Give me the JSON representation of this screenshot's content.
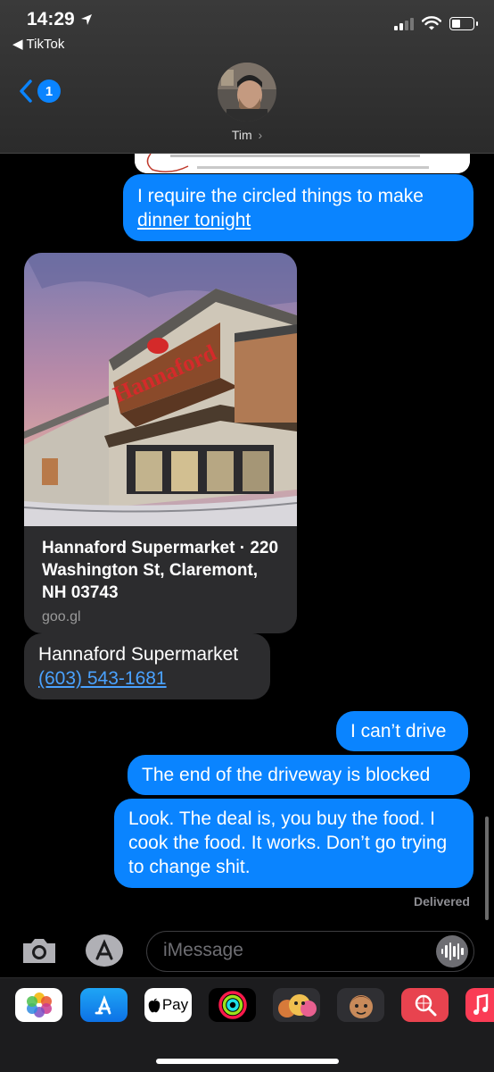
{
  "status_bar": {
    "time": "14:29",
    "back_app": "TikTok"
  },
  "header": {
    "back_badge_count": "1",
    "contact_name": "Tim",
    "contact_chevron": "›"
  },
  "messages": [
    {
      "direction": "outgoing",
      "text_before": "I require the circled things to make ",
      "link": "dinner tonight"
    },
    {
      "direction": "incoming",
      "type": "link_preview",
      "title": "Hannaford Supermarket · 220 Washington St, Claremont, NH 03743",
      "domain": "goo.gl"
    },
    {
      "direction": "incoming",
      "text": "Hannaford Supermarket",
      "link": "(603) 543-1681"
    },
    {
      "direction": "outgoing",
      "text": "I can’t drive"
    },
    {
      "direction": "outgoing",
      "text": "The end of the driveway is blocked"
    },
    {
      "direction": "outgoing",
      "text": "Look. The deal is, you buy the food. I cook the food. It works. Don’t go trying to change shit."
    }
  ],
  "preview_sign": "Hannaford",
  "delivered_label": "Delivered",
  "input": {
    "placeholder": "iMessage"
  },
  "drawer_apps": [
    "photos-icon",
    "app-store-icon",
    "apple-pay-icon",
    "activity-icon",
    "memoji-icon",
    "memoji-2-icon",
    "web-search-icon",
    "music-icon"
  ],
  "apple_pay_label": "Pay",
  "colors": {
    "outgoing_bubble": "#0a84ff",
    "incoming_bubble": "#2c2c2e",
    "link_incoming": "#4aa2ff",
    "background": "#000000"
  }
}
